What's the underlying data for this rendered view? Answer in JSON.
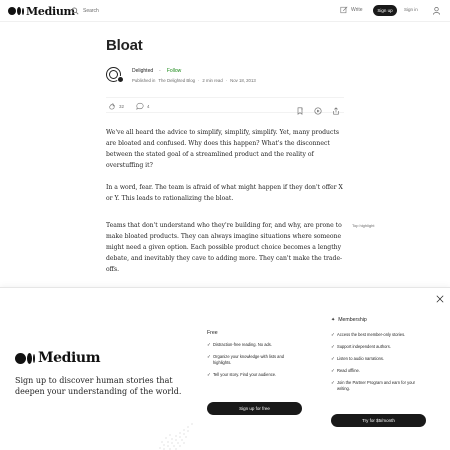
{
  "nav": {
    "logo": "Medium",
    "search_placeholder": "Search",
    "write_label": "Write",
    "signup_label": "Sign up",
    "signin_label": "Sign in"
  },
  "article": {
    "title": "Bloat",
    "author": "Delighted",
    "follow_label": "Follow",
    "published_in": "Published in",
    "publication": "The Delighted Blog",
    "read_time": "2 min read",
    "date": "Nov 18, 2013",
    "claps": "32",
    "responses": "4",
    "paragraphs": [
      "We've all heard the advice to simplify, simplify, simplify. Yet, many products are bloated and confused. Why does this happen? What's the disconnect between the stated goal of a streamlined product and the reality of overstuffing it?",
      "In a word, fear. The team is afraid of what might happen if they don't offer X or Y. This leads to rationalizing the bloat.",
      "Teams that don't understand who they're building for, and why, are prone to make bloated products. They can always imagine situations where someone might need a given option. Each possible product choice becomes a lengthy debate, and inevitably they cave to adding more. They can't make the trade-offs."
    ],
    "top_highlight": "Top highlight"
  },
  "signup_modal": {
    "logo": "Medium",
    "tagline": "Sign up to discover human stories that deepen your understanding of the world.",
    "free": {
      "title": "Free",
      "features": [
        "Distraction-free reading. No ads.",
        "Organize your knowledge with lists and highlights.",
        "Tell your story. Find your audience."
      ],
      "button": "Sign up for free"
    },
    "membership": {
      "title": "Membership",
      "features": [
        "Access the best member-only stories.",
        "Support independent authors.",
        "Listen to audio narrations.",
        "Read offline.",
        "Join the Partner Program and earn for your writing."
      ],
      "button": "Try for $5/month"
    }
  },
  "colors": {
    "accent": "#1a8917",
    "text": "#242424",
    "muted": "#6b6b6b",
    "button": "#191919"
  },
  "icons": [
    "search-icon",
    "write-icon",
    "user-icon",
    "clap-icon",
    "comment-icon",
    "bookmark-icon",
    "play-icon",
    "share-icon",
    "close-icon",
    "star-icon",
    "check-icon"
  ]
}
